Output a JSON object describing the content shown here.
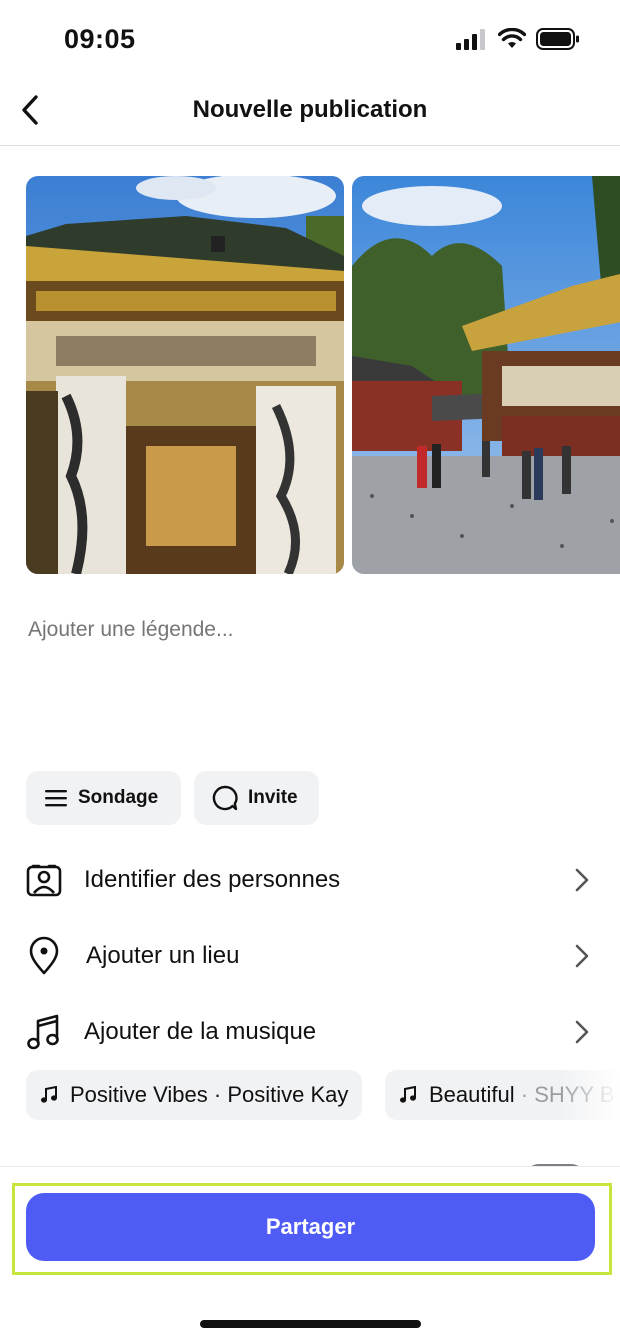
{
  "status": {
    "time": "09:05"
  },
  "header": {
    "title": "Nouvelle publication"
  },
  "caption": {
    "placeholder": "Ajouter une légende..."
  },
  "chips": {
    "poll": "Sondage",
    "prompt": "Invite"
  },
  "options": [
    {
      "label": "Identifier des personnes",
      "icon": "tag-person-icon"
    },
    {
      "label": "Ajouter un lieu",
      "icon": "location-pin-icon"
    },
    {
      "label": "Ajouter de la musique",
      "icon": "music-note-icon"
    }
  ],
  "music_suggestions": [
    {
      "title": "Positive Vibes",
      "sep": " · ",
      "artist": "Positive Kay"
    },
    {
      "title": "Beautiful",
      "sep": " · ",
      "artist": "SHYY B"
    }
  ],
  "actions": {
    "share_label": "Partager"
  },
  "colors": {
    "accent": "#4e5cf5",
    "highlight_outline": "#c6e53d",
    "chip_bg": "#f1f2f4"
  }
}
